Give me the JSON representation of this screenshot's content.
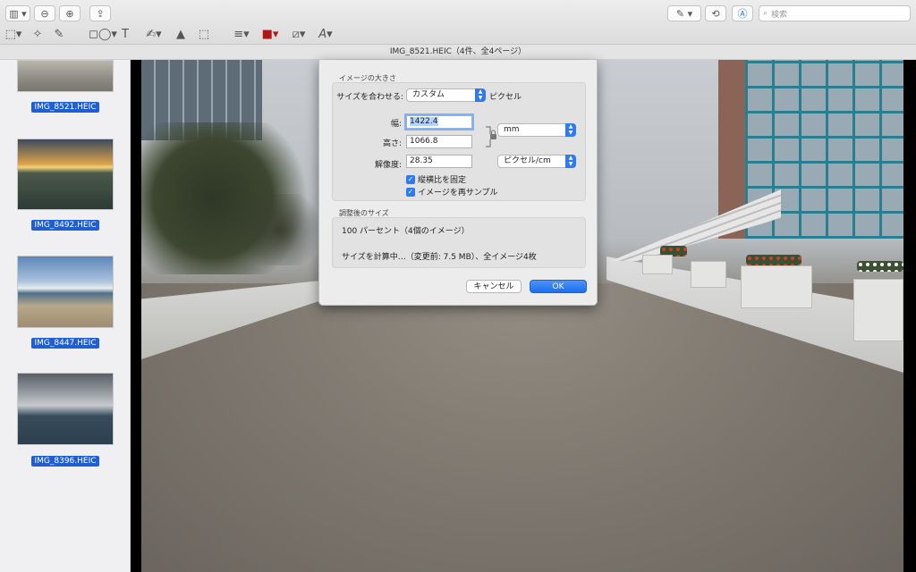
{
  "toolbar": {
    "sidebar_toggle": "▥ ▾",
    "zoom_out": "⊖",
    "zoom_in": "⊕",
    "share": "⇪",
    "search_placeholder": "検索",
    "markup_tools": [
      "⬚▾",
      "✧",
      "✎",
      "◻◯▾",
      "T",
      "✍▾",
      "▲",
      "⬚",
      "≡▾",
      "■▾",
      "⧄▾",
      "A▾"
    ],
    "right_icons": [
      "✎ ▾",
      "⟲",
      "Ⓐ"
    ]
  },
  "window": {
    "title": "IMG_8521.HEIC（4件、全4ページ）"
  },
  "sidebar": {
    "items": [
      {
        "label": "IMG_8521.HEIC"
      },
      {
        "label": "IMG_8492.HEIC"
      },
      {
        "label": "IMG_8447.HEIC"
      },
      {
        "label": "IMG_8396.HEIC"
      }
    ]
  },
  "dialog": {
    "section_size_title": "イメージの大きさ",
    "fit_label": "サイズを合わせる:",
    "fit_value": "カスタム",
    "fit_unit": "ピクセル",
    "width_label": "幅:",
    "width_value": "1422.4",
    "height_label": "高さ:",
    "height_value": "1066.8",
    "resolution_label": "解像度:",
    "resolution_value": "28.35",
    "size_unit": "mm",
    "resolution_unit": "ピクセル/cm",
    "check_scale": "縦横比を固定",
    "check_resample": "イメージを再サンプル",
    "section_result_title": "調整後のサイズ",
    "result_percent": "100 パーセント（4個のイメージ）",
    "result_calc": "サイズを計算中…（変更前: 7.5 MB）、全イメージ4枚",
    "cancel_label": "キャンセル",
    "ok_label": "OK"
  },
  "colors": {
    "accent": "#2d7af2",
    "selection": "#1f5fd6"
  }
}
